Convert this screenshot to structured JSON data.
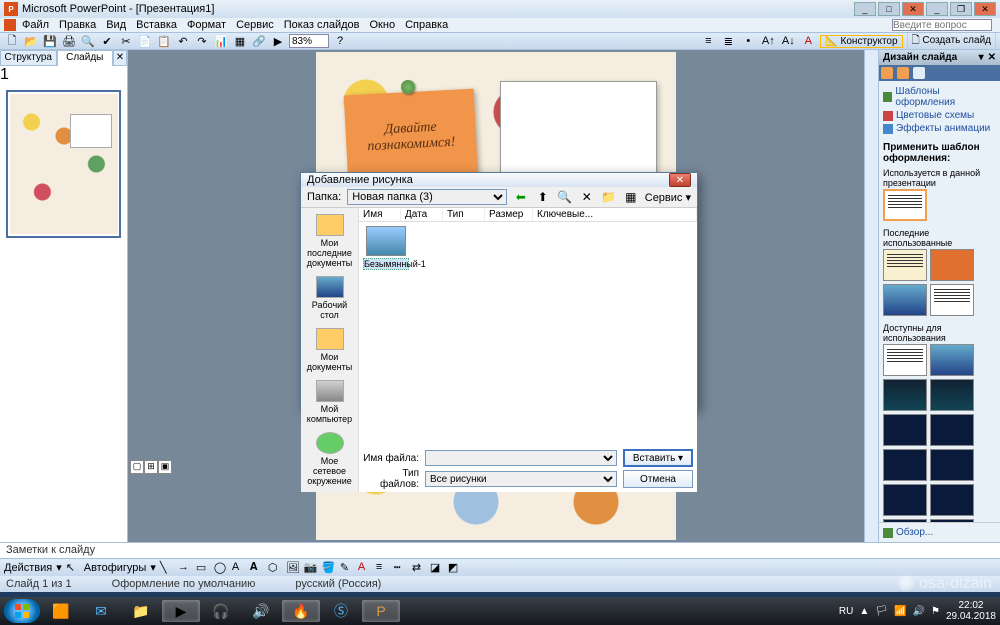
{
  "titlebar": {
    "app": "Microsoft PowerPoint - [Презентация1]"
  },
  "menu": [
    "Файл",
    "Правка",
    "Вид",
    "Вставка",
    "Формат",
    "Сервис",
    "Показ слайдов",
    "Окно",
    "Справка"
  ],
  "ask_placeholder": "Введите вопрос",
  "zoom": "83%",
  "designer_btn": "Конструктор",
  "newslide_btn": "Создать слайд",
  "tabs": {
    "outline": "Структура",
    "slides": "Слайды"
  },
  "thumb_number": "1",
  "slide_note_text": "Давайте познакомимся!",
  "notes_placeholder": "Заметки к слайду",
  "drawbar": {
    "actions": "Действия",
    "autoshapes": "Автофигуры"
  },
  "status": {
    "slide": "Слайд 1 из 1",
    "template": "Оформление по умолчанию",
    "lang": "русский (Россия)"
  },
  "taskpane": {
    "title": "Дизайн слайда",
    "links": [
      "Шаблоны оформления",
      "Цветовые схемы",
      "Эффекты анимации"
    ],
    "apply": "Применить шаблон оформления:",
    "sec1": "Используется в данной презентации",
    "sec2": "Последние использованные",
    "sec3": "Доступны для использования",
    "browse": "Обзор..."
  },
  "dialog": {
    "title": "Добавление рисунка",
    "folder_label": "Папка:",
    "folder_value": "Новая папка (3)",
    "service": "Сервис",
    "cols": [
      "Имя",
      "Дата",
      "Тип",
      "Размер",
      "Ключевые..."
    ],
    "places": [
      "Мои последние документы",
      "Рабочий стол",
      "Мои документы",
      "Мой компьютер",
      "Мое сетевое окружение"
    ],
    "file": "Безымянный-1",
    "fname_label": "Имя файла:",
    "ftype_label": "Тип файлов:",
    "ftype_value": "Все рисунки",
    "insert": "Вставить",
    "cancel": "Отмена"
  },
  "tray": {
    "lang": "RU",
    "time": "22:02",
    "date": "29.04.2018"
  },
  "watermark": "osa-dizain"
}
